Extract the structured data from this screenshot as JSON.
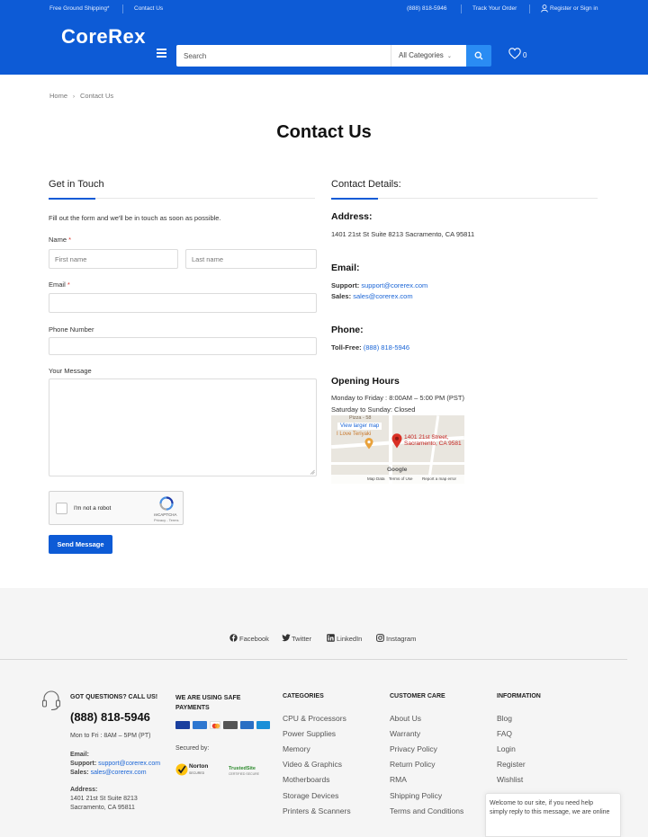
{
  "topbar": {
    "free_shipping": "Free Ground Shipping*",
    "contact": "Contact Us",
    "phone": "(888) 818-5946",
    "track": "Track Your Order",
    "register": "Register or Sign in"
  },
  "header": {
    "logo": "CoreRex",
    "search_placeholder": "Search",
    "category_selected": "All Categories",
    "wishlist_count": "0"
  },
  "breadcrumb": {
    "home": "Home",
    "current": "Contact Us"
  },
  "page": {
    "title": "Contact Us"
  },
  "form": {
    "title": "Get in Touch",
    "intro": "Fill out the form and we'll be in touch as soon as possible.",
    "name_label": "Name",
    "required_mark": "*",
    "first_name_placeholder": "First name",
    "last_name_placeholder": "Last name",
    "email_label": "Email",
    "phone_label": "Phone Number",
    "message_label": "Your Message",
    "recaptcha_label": "I'm not a robot",
    "recaptcha_brand": "reCAPTCHA",
    "recaptcha_links": "Privacy - Terms",
    "send_label": "Send Message"
  },
  "details": {
    "title": "Contact Details:",
    "address_heading": "Address:",
    "address": "1401 21st St Suite 8213 Sacramento, CA 95811",
    "email_heading": "Email:",
    "support_label": "Support:",
    "support_email": "support@corerex.com",
    "sales_label": "Sales:",
    "sales_email": "sales@corerex.com",
    "phone_heading": "Phone:",
    "tollfree_label": "Toll-Free:",
    "tollfree_number": "(888) 818-5946",
    "hours_heading": "Opening Hours",
    "hours_weekday": "Monday to Friday : 8:00AM – 5:00 PM (PST)",
    "hours_weekend": "Saturday to Sunday: Closed"
  },
  "map": {
    "view_larger": "View larger map",
    "teriyaki": "I Love Teriyaki",
    "pizza": "Pizza - 58",
    "pin_line1": "1401 21st Street,",
    "pin_line2": "Sacramento, CA 9581",
    "google": "Google",
    "map_data": "Map Data",
    "terms": "Terms of Use",
    "report": "Report a map error"
  },
  "social": {
    "facebook": "Facebook",
    "twitter": "Twitter",
    "linkedin": "LinkedIn",
    "instagram": "Instagram"
  },
  "footer": {
    "questions_heading": "GOT QUESTIONS? CALL US!",
    "phone": "(888) 818-5946",
    "hours": "Mon to Fri : 8AM – 5PM (PT)",
    "email_heading": "Email:",
    "support_label": "Support:",
    "support_email": "support@corerex.com",
    "sales_label": "Sales:",
    "sales_email": "sales@corerex.com",
    "address_heading": "Address:",
    "address_line1": "1401 21st St Suite 8213",
    "address_line2": "Sacramento, CA 95811",
    "payments_heading_1": "WE ARE USING SAFE",
    "payments_heading_2": "PAYMENTS",
    "secured_by": "Secured by:",
    "norton": "Norton",
    "norton_sub": "SECURED",
    "trusted": "TrustedSite",
    "trusted_sub": "CERTIFIED SECURE",
    "categories_heading": "CATEGORIES",
    "categories": [
      "CPU & Processors",
      "Power Supplies",
      "Memory",
      "Video & Graphics",
      "Motherboards",
      "Storage Devices",
      "Printers & Scanners"
    ],
    "care_heading": "CUSTOMER CARE",
    "care": [
      "About Us",
      "Warranty",
      "Privacy Policy",
      "Return Policy",
      "RMA",
      "Shipping Policy",
      "Terms and Conditions"
    ],
    "info_heading": "INFORMATION",
    "info": [
      "Blog",
      "FAQ",
      "Login",
      "Register",
      "Wishlist"
    ]
  },
  "chat": {
    "line1": "Welcome to our site, if you need help",
    "line2": "simply reply to this message, we are online"
  },
  "colors": {
    "brand": "#0d5bd6",
    "accent": "#2a8cf3",
    "link": "#1a65d6",
    "required": "#d9352d"
  },
  "icons": [
    "menu-icon",
    "search-icon",
    "heart-icon",
    "user-icon",
    "facebook-icon",
    "twitter-icon",
    "linkedin-icon",
    "instagram-icon",
    "headset-icon",
    "map-pin-icon",
    "recaptcha-icon"
  ]
}
